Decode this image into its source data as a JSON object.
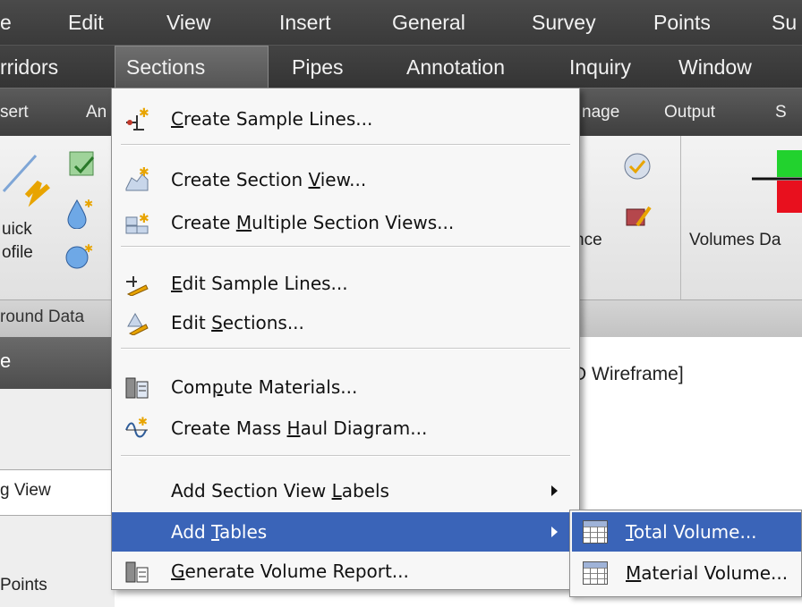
{
  "menubar": {
    "row1": [
      "e",
      "Edit",
      "View",
      "Insert",
      "General",
      "Survey",
      "Points",
      "Su"
    ],
    "row2": [
      "rridors",
      "Sections",
      "Pipes",
      "Annotation",
      "Inquiry",
      "Window"
    ]
  },
  "ribbon_tabs": [
    "sert",
    "An",
    "nage",
    "Output",
    "S"
  ],
  "ribbon": {
    "quick_profile_1": "uick",
    "quick_profile_2": "ofile",
    "ground_data": "round Data",
    "nce": "nce",
    "volumes": "Volumes Da"
  },
  "lower": {
    "title_fragment": "e",
    "view_label": "g View",
    "points_label": "Points",
    "drawing_label": "D Wireframe]"
  },
  "sections_menu": {
    "items": [
      {
        "label": "Create Sample Lines...",
        "ul": "C",
        "icon": "create-sample-lines-icon"
      },
      {
        "label": "Create Section View...",
        "ul": "V",
        "icon": "create-section-view-icon"
      },
      {
        "label": "Create Multiple Section Views...",
        "ul": "M",
        "icon": "create-multiple-section-views-icon"
      },
      {
        "label": "Edit Sample Lines...",
        "ul": "E",
        "icon": "edit-sample-lines-icon"
      },
      {
        "label": "Edit Sections...",
        "ul": "S",
        "icon": "edit-sections-icon"
      },
      {
        "label": "Compute Materials...",
        "ul": "p",
        "icon": "compute-materials-icon"
      },
      {
        "label": "Create Mass Haul Diagram...",
        "ul": "H",
        "icon": "mass-haul-icon"
      },
      {
        "label": "Add Section View Labels",
        "ul": "L"
      },
      {
        "label": "Add Tables",
        "ul": "T"
      },
      {
        "label": "Generate Volume Report...",
        "ul": "G",
        "icon": "volume-report-icon"
      }
    ]
  },
  "tables_submenu": {
    "items": [
      {
        "label": "Total Volume...",
        "ul": "T"
      },
      {
        "label": "Material Volume...",
        "ul": "M"
      }
    ]
  },
  "colors": {
    "highlight": "#3a64b8",
    "menubar": "#3e3e3e"
  }
}
